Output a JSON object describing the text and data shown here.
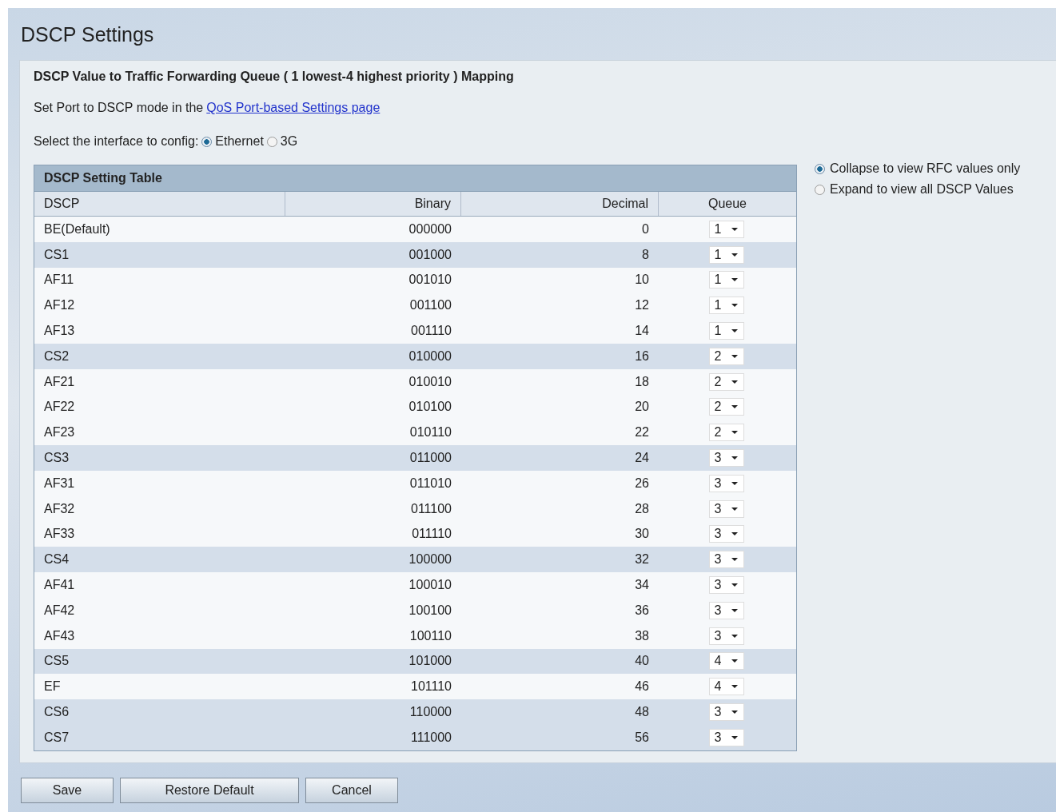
{
  "page_title": "DSCP Settings",
  "section_heading": "DSCP Value to Traffic Forwarding Queue ( 1 lowest-4 highest priority ) Mapping",
  "port_note": {
    "text": "Set Port to DSCP mode in the",
    "link": "QoS Port-based Settings page"
  },
  "interface": {
    "label": "Select the interface to config:",
    "options": [
      {
        "label": "Ethernet",
        "selected": true
      },
      {
        "label": "3G",
        "selected": false
      }
    ]
  },
  "table": {
    "title": "DSCP Setting Table",
    "columns": [
      "DSCP",
      "Binary",
      "Decimal",
      "Queue"
    ],
    "rows": [
      {
        "dscp": "BE(Default)",
        "binary": "000000",
        "decimal": "0",
        "queue": "1",
        "highlighted": false
      },
      {
        "dscp": "CS1",
        "binary": "001000",
        "decimal": "8",
        "queue": "1",
        "highlighted": true
      },
      {
        "dscp": "AF11",
        "binary": "001010",
        "decimal": "10",
        "queue": "1",
        "highlighted": false
      },
      {
        "dscp": "AF12",
        "binary": "001100",
        "decimal": "12",
        "queue": "1",
        "highlighted": false
      },
      {
        "dscp": "AF13",
        "binary": "001110",
        "decimal": "14",
        "queue": "1",
        "highlighted": false
      },
      {
        "dscp": "CS2",
        "binary": "010000",
        "decimal": "16",
        "queue": "2",
        "highlighted": true
      },
      {
        "dscp": "AF21",
        "binary": "010010",
        "decimal": "18",
        "queue": "2",
        "highlighted": false
      },
      {
        "dscp": "AF22",
        "binary": "010100",
        "decimal": "20",
        "queue": "2",
        "highlighted": false
      },
      {
        "dscp": "AF23",
        "binary": "010110",
        "decimal": "22",
        "queue": "2",
        "highlighted": false
      },
      {
        "dscp": "CS3",
        "binary": "011000",
        "decimal": "24",
        "queue": "3",
        "highlighted": true
      },
      {
        "dscp": "AF31",
        "binary": "011010",
        "decimal": "26",
        "queue": "3",
        "highlighted": false
      },
      {
        "dscp": "AF32",
        "binary": "011100",
        "decimal": "28",
        "queue": "3",
        "highlighted": false
      },
      {
        "dscp": "AF33",
        "binary": "011110",
        "decimal": "30",
        "queue": "3",
        "highlighted": false
      },
      {
        "dscp": "CS4",
        "binary": "100000",
        "decimal": "32",
        "queue": "3",
        "highlighted": true
      },
      {
        "dscp": "AF41",
        "binary": "100010",
        "decimal": "34",
        "queue": "3",
        "highlighted": false
      },
      {
        "dscp": "AF42",
        "binary": "100100",
        "decimal": "36",
        "queue": "3",
        "highlighted": false
      },
      {
        "dscp": "AF43",
        "binary": "100110",
        "decimal": "38",
        "queue": "3",
        "highlighted": false
      },
      {
        "dscp": "CS5",
        "binary": "101000",
        "decimal": "40",
        "queue": "4",
        "highlighted": true
      },
      {
        "dscp": "EF",
        "binary": "101110",
        "decimal": "46",
        "queue": "4",
        "highlighted": false
      },
      {
        "dscp": "CS6",
        "binary": "110000",
        "decimal": "48",
        "queue": "3",
        "highlighted": true
      },
      {
        "dscp": "CS7",
        "binary": "111000",
        "decimal": "56",
        "queue": "3",
        "highlighted": true
      }
    ]
  },
  "view_options": [
    {
      "label": "Collapse to view RFC values only",
      "selected": true
    },
    {
      "label": "Expand to view all DSCP Values",
      "selected": false
    }
  ],
  "buttons": [
    "Save",
    "Restore Default",
    "Cancel"
  ]
}
